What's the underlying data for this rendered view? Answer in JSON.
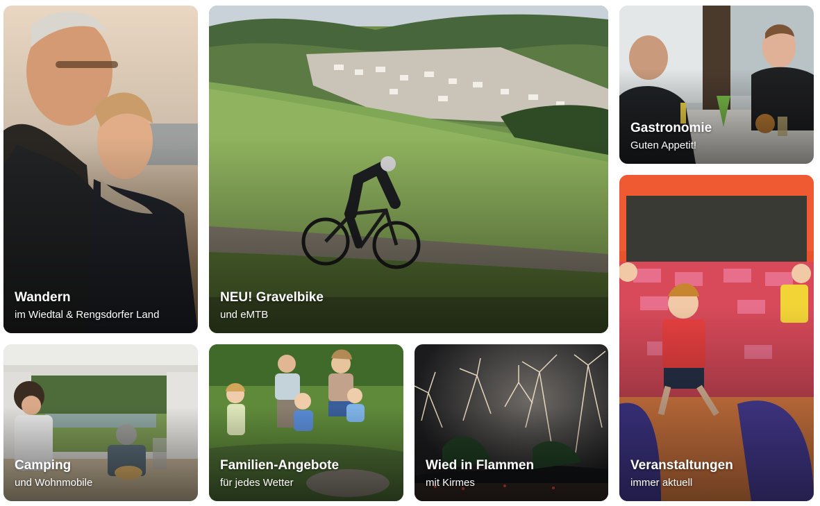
{
  "tiles": [
    {
      "id": "wandern",
      "title": "Wandern",
      "subtitle": "im Wiedtal & Rengsdorfer Land"
    },
    {
      "id": "gravelbike",
      "title": "NEU! Gravelbike",
      "subtitle": "und eMTB"
    },
    {
      "id": "gastronomie",
      "title": "Gastronomie",
      "subtitle": "Guten Appetit!"
    },
    {
      "id": "camping",
      "title": "Camping",
      "subtitle": "und Wohnmobile"
    },
    {
      "id": "familien",
      "title": "Familien-Angebote",
      "subtitle": "für jedes Wetter"
    },
    {
      "id": "flammen",
      "title": "Wied in Flammen",
      "subtitle": "mit Kirmes"
    },
    {
      "id": "veranstaltungen",
      "title": "Veranstaltungen",
      "subtitle": "immer aktuell"
    }
  ]
}
